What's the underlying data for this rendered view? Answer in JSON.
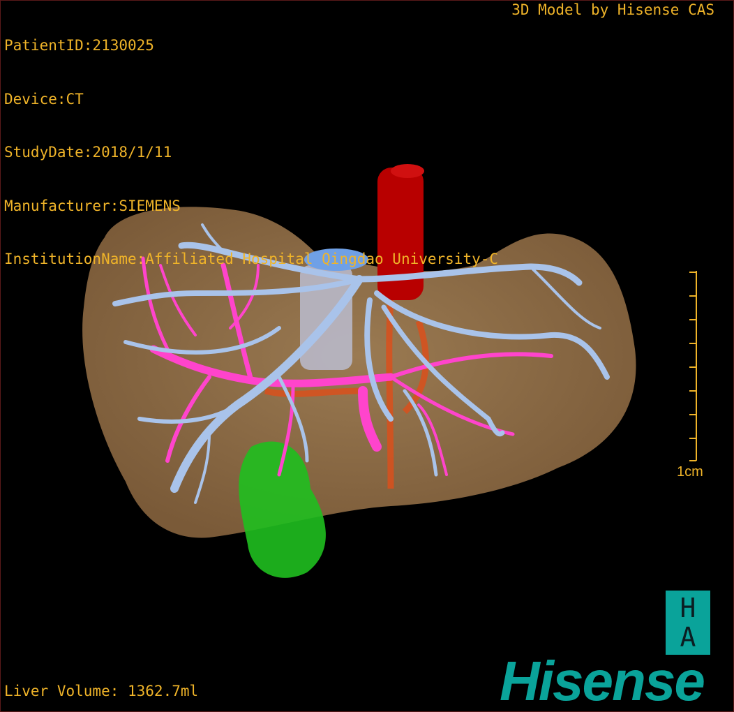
{
  "overlay": {
    "patient_id": "PatientID:2130025",
    "device": "Device:CT",
    "study_date": "StudyDate:2018/1/11",
    "manufacturer": "Manufacturer:SIEMENS",
    "institution": "InstitutionName:Affiliated Hospital Qingdao University-C",
    "model_credit": "3D Model by Hisense CAS",
    "liver_volume": "Liver Volume: 1362.7ml"
  },
  "scale_bar": {
    "label": "1cm"
  },
  "logo": {
    "ha_top": "H",
    "ha_bottom": "A",
    "brand": "Hisense"
  },
  "colors": {
    "overlay_text": "#f0b429",
    "liver": "#8a6a44",
    "portal_vein": "#ff55cc",
    "hepatic_vein": "#a9c3ea",
    "aorta": "#c00000",
    "artery": "#d9501c",
    "gallbladder": "#22aa22",
    "logo": "#0aa39a"
  }
}
